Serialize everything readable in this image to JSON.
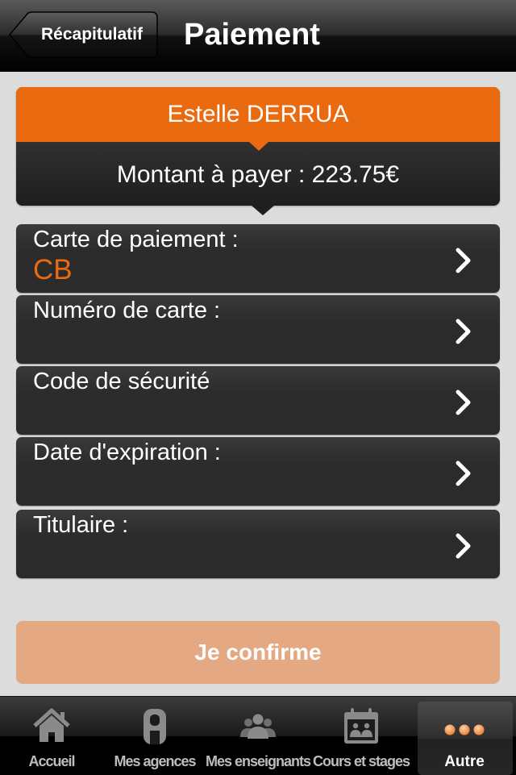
{
  "header": {
    "back_label": "Récapitulatif",
    "title": "Paiement"
  },
  "summary": {
    "name": "Estelle DERRUA",
    "amount_text": "Montant à payer : 223.75€"
  },
  "form": {
    "rows": [
      {
        "label": "Carte de paiement :",
        "value": "CB"
      },
      {
        "label": "Numéro de carte :",
        "value": ""
      },
      {
        "label": "Code de sécurité",
        "value": ""
      },
      {
        "label": "Date d'expiration :",
        "value": ""
      },
      {
        "label": "Titulaire :",
        "value": ""
      }
    ]
  },
  "confirm_label": "Je confirme",
  "tabbar": {
    "tabs": [
      {
        "label": "Accueil",
        "icon": "home-icon"
      },
      {
        "label": "Mes agences",
        "icon": "agency-icon"
      },
      {
        "label": "Mes enseignants",
        "icon": "teachers-icon"
      },
      {
        "label": "Cours et stages",
        "icon": "calendar-icon"
      },
      {
        "label": "Autre",
        "icon": "more-icon",
        "active": true
      }
    ]
  },
  "colors": {
    "accent": "#ea6a10",
    "confirm_disabled": "#e4a883",
    "row_bg": "#2b2b2b",
    "page_bg": "#dcdcdc"
  }
}
